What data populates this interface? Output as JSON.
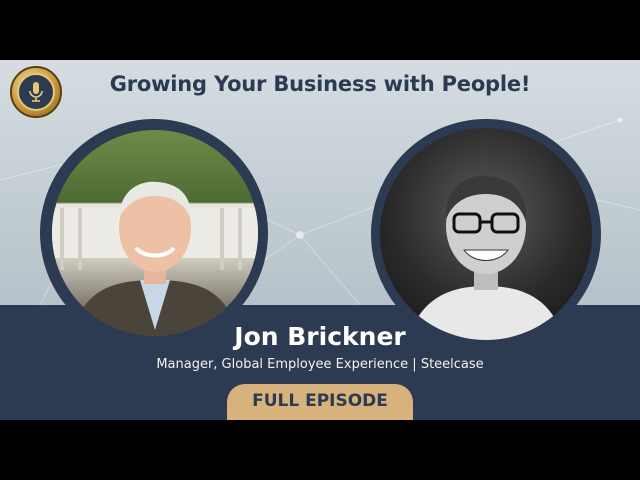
{
  "headline": "Growing Your Business with People!",
  "guest": {
    "name": "Jon Brickner",
    "role": "Manager, Global Employee Experience | Steelcase"
  },
  "badge": "FULL EPISODE",
  "icons": {
    "logo": "podcast-microphone-logo-icon"
  },
  "colors": {
    "navy": "#2d3b52",
    "gold": "#d8b27d",
    "background": "#c2ccd3"
  }
}
